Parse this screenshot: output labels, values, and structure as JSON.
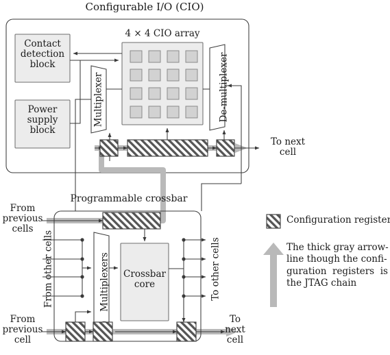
{
  "figure": {
    "title": "Configurable I/O (CIO)",
    "colors": {
      "line": "#3a3a3a",
      "block_fill": "#ececec",
      "block_stroke": "#6e6e6e",
      "register_fill": "#ffffff",
      "hatch": "#4a4a4a",
      "jtag_gray": "#b3b3b3",
      "text": "#1a1a1a"
    }
  },
  "cio_block": {
    "title": "Configurable I/O (CIO)",
    "contact_detection_block": "Contact\ndetection\nblock",
    "power_supply_block": "Power\nsupply\nblock",
    "array_title": "4 × 4 CIO array",
    "array_rows": 4,
    "array_cols": 4,
    "multiplexer_label": "Multiplexer",
    "demultiplexer_label": "De-multiplexer",
    "to_next_cell": "To next\ncell",
    "registers": [
      {
        "name": "cio-mux-config-register"
      },
      {
        "name": "cio-array-config-register"
      },
      {
        "name": "cio-demux-config-register"
      }
    ]
  },
  "crossbar_block": {
    "title": "Programmable crossbar",
    "from_previous_cells": "From\nprevious\ncells",
    "from_other_cells": "From other cells",
    "to_other_cells": "To other cells",
    "from_previous_cell": "From\nprevious\ncell",
    "to_next_cell": "To\nnext\ncell",
    "multiplexers_label": "Multiplexers",
    "crossbar_core_label": "Crossbar\ncore",
    "other_cell_lines": 4,
    "registers": [
      {
        "name": "crossbar-core-config-register"
      },
      {
        "name": "crossbar-chain-register-1"
      },
      {
        "name": "crossbar-chain-register-2"
      },
      {
        "name": "crossbar-chain-register-3"
      }
    ]
  },
  "legend": {
    "register_label": "Configuration register",
    "jtag_note": "The thick gray arrow-\nline though the confi-\nguration  registers  is\nthe JTAG chain"
  }
}
